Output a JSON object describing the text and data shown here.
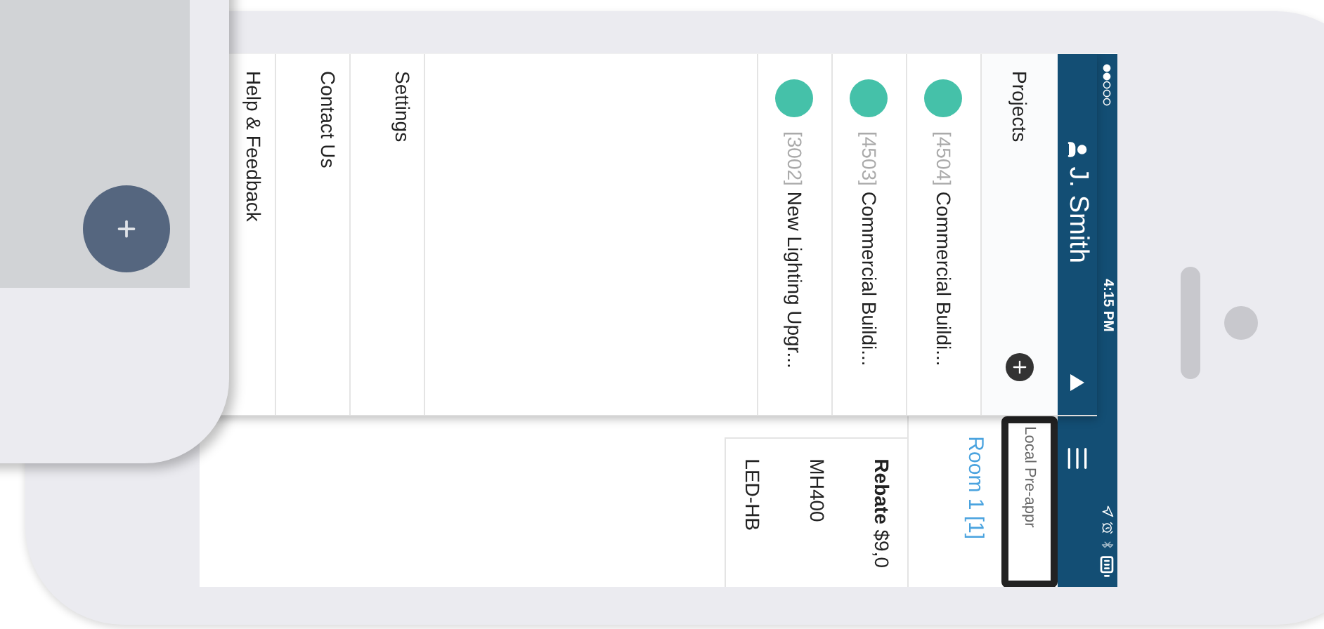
{
  "status_bar": {
    "time": "4:15 PM"
  },
  "drawer": {
    "user": "J. Smith",
    "projects_header": "Projects",
    "projects": [
      {
        "id": "[4504]",
        "name": "Commercial Buildi...",
        "color": "#45c1a9"
      },
      {
        "id": "[4503]",
        "name": "Commercial Buildi...",
        "color": "#45c1a9"
      },
      {
        "id": "[3002]",
        "name": "New Lighting Upgr...",
        "color": "#45c1a9"
      }
    ],
    "menu": [
      "Settings",
      "Contact Us",
      "Help & Feedback"
    ]
  },
  "main": {
    "search": {
      "value": "Local Pre-appr"
    },
    "room": "Room 1 [1]",
    "rebate": "**Rebate** $9,0",
    "items": [
      "MH400",
      "LED-HB"
    ]
  }
}
